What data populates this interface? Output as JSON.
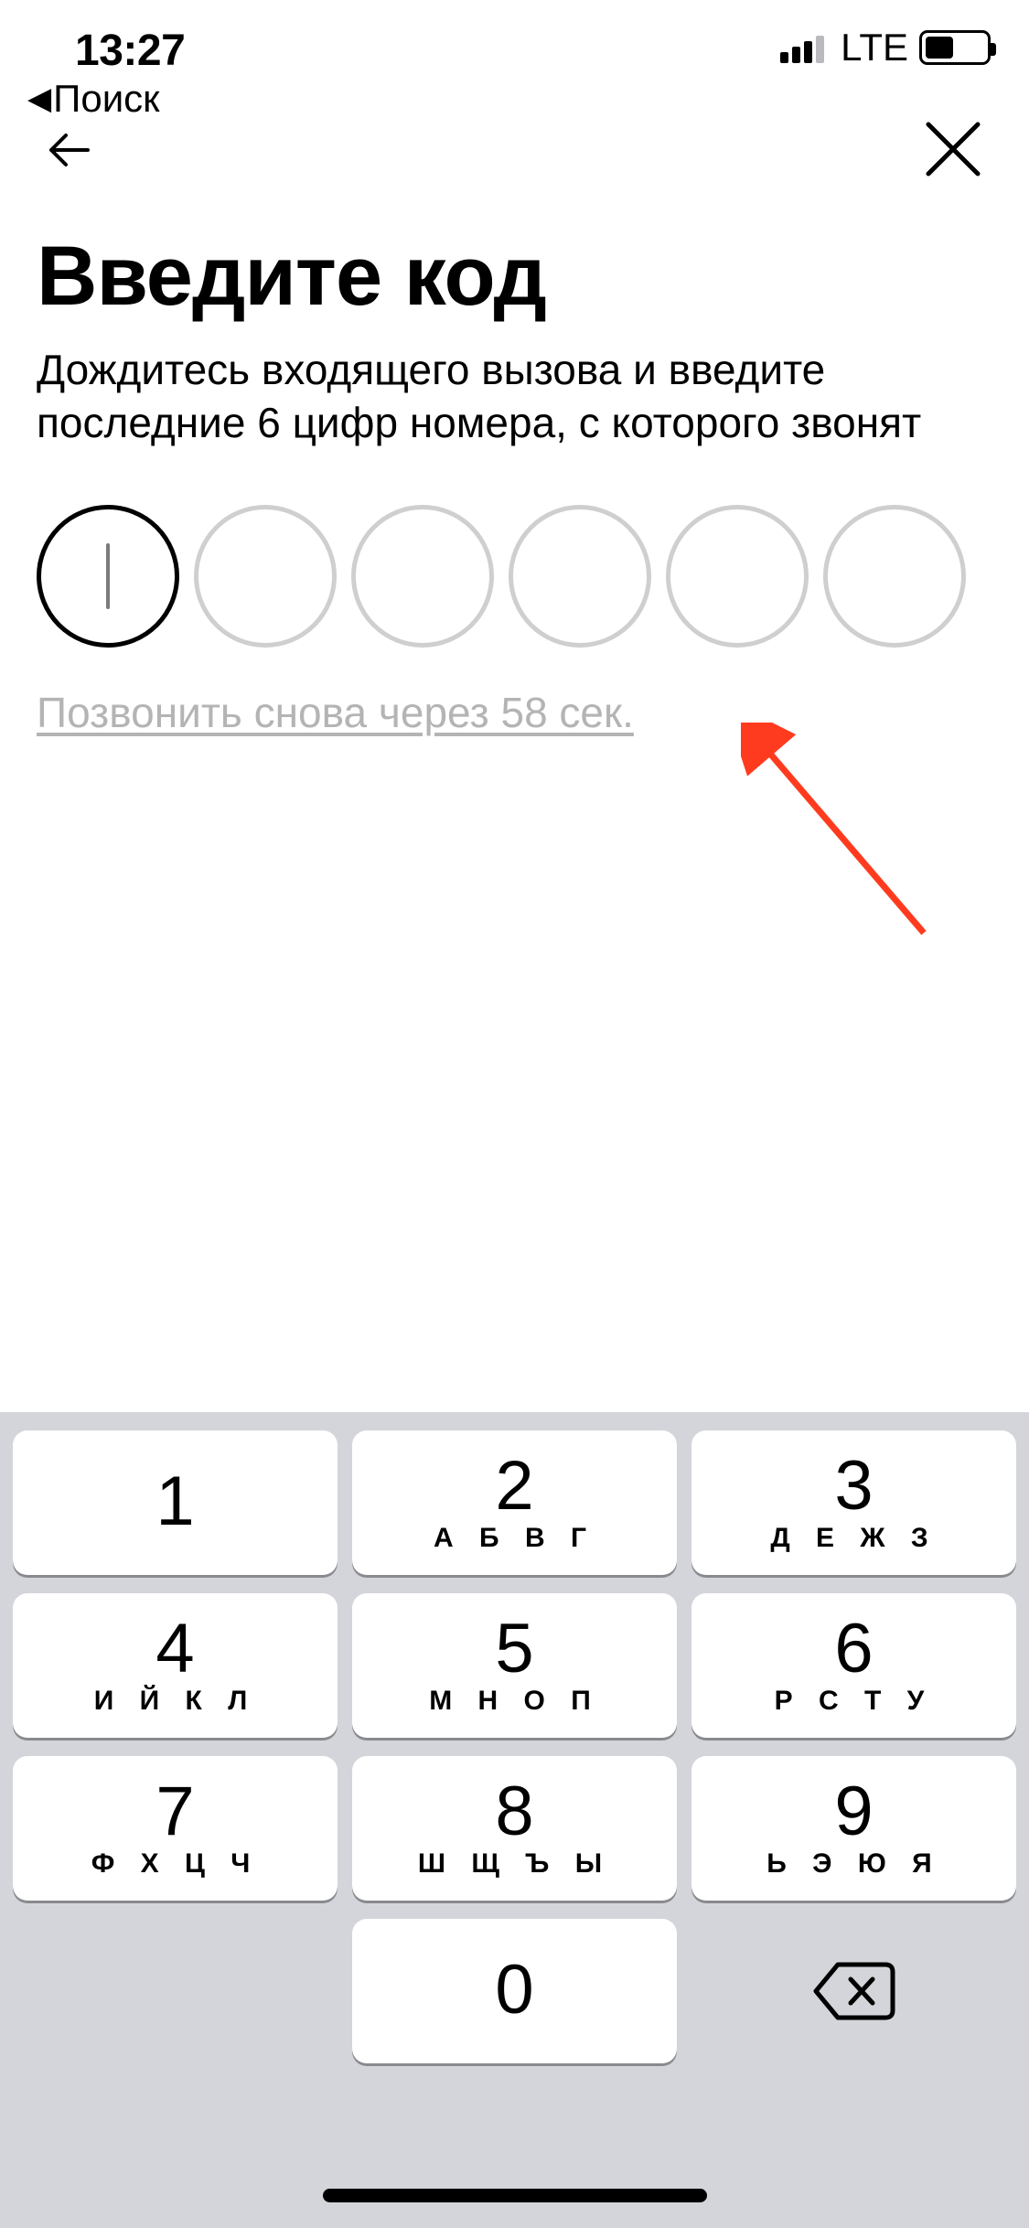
{
  "status": {
    "time": "13:27",
    "network_label": "LTE",
    "battery_percent": 45
  },
  "breadcrumb": {
    "label": "Поиск"
  },
  "page": {
    "title": "Введите код",
    "subtitle": "Дождитесь входящего вызова и введите последние 6 цифр номера, с которого звонят",
    "code_length": 6,
    "call_again_label": "Позвонить снова через 58 сек."
  },
  "keypad": {
    "keys": [
      {
        "digit": "1",
        "letters": ""
      },
      {
        "digit": "2",
        "letters": "А Б В Г"
      },
      {
        "digit": "3",
        "letters": "Д Е Ж З"
      },
      {
        "digit": "4",
        "letters": "И Й К Л"
      },
      {
        "digit": "5",
        "letters": "М Н О П"
      },
      {
        "digit": "6",
        "letters": "Р С Т У"
      },
      {
        "digit": "7",
        "letters": "Ф Х Ц Ч"
      },
      {
        "digit": "8",
        "letters": "Ш Щ Ъ Ы"
      },
      {
        "digit": "9",
        "letters": "Ь Э Ю Я"
      },
      {
        "digit": "0",
        "letters": ""
      }
    ]
  },
  "annotation": {
    "arrow_color": "#ff3b1f"
  }
}
